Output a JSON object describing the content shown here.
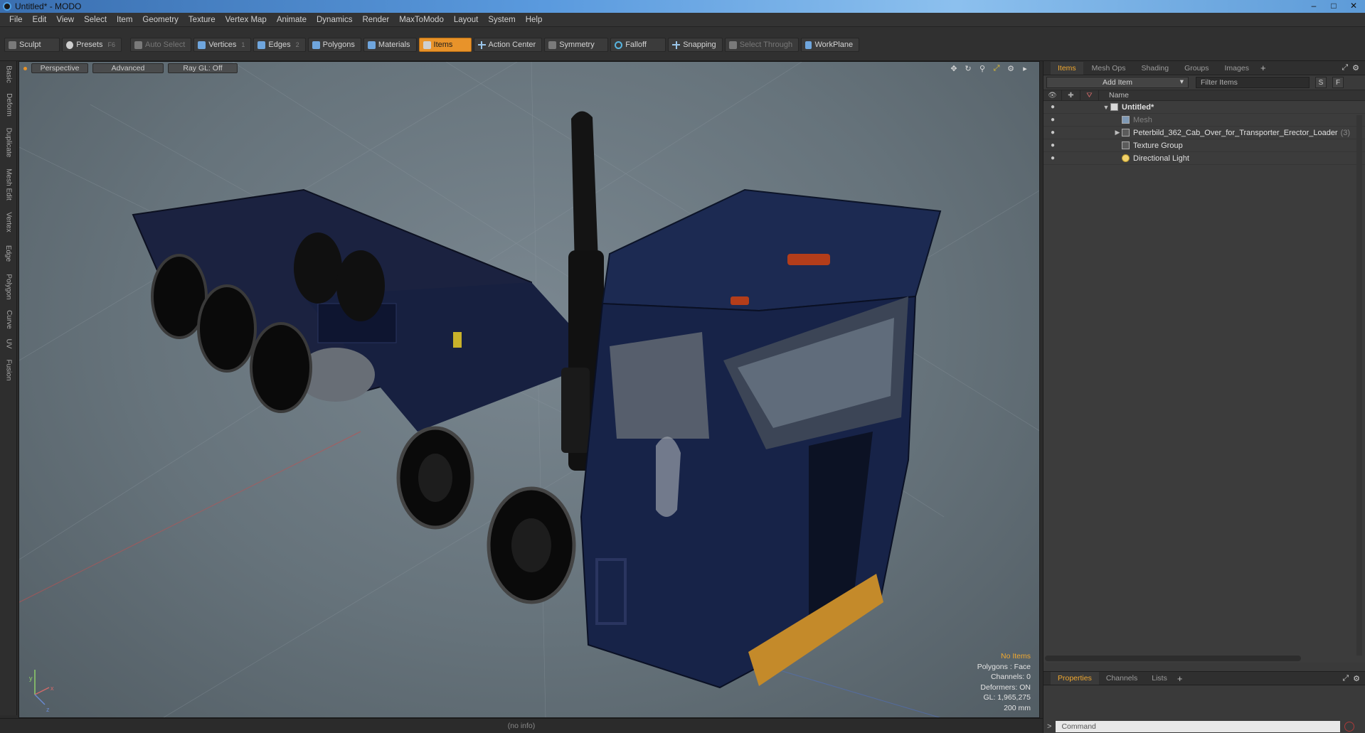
{
  "window": {
    "title": "Untitled* - MODO",
    "controls": [
      "–",
      "□",
      "✕"
    ]
  },
  "menu": [
    "File",
    "Edit",
    "View",
    "Select",
    "Item",
    "Geometry",
    "Texture",
    "Vertex Map",
    "Animate",
    "Dynamics",
    "Render",
    "MaxToModo",
    "Layout",
    "System",
    "Help"
  ],
  "toolbar": {
    "sculpt": "Sculpt",
    "presets": "Presets",
    "presets_key": "F6",
    "auto_select": "Auto Select",
    "vertices": "Vertices",
    "vertices_key": "1",
    "edges": "Edges",
    "edges_key": "2",
    "polygons": "Polygons",
    "materials": "Materials",
    "items": "Items",
    "action_center": "Action Center",
    "symmetry": "Symmetry",
    "falloff": "Falloff",
    "snapping": "Snapping",
    "select_through": "Select Through",
    "workplane": "WorkPlane",
    "accent": "#e8932a"
  },
  "left_tabs": [
    "Basic",
    "Deform",
    "Duplicate",
    "Mesh Edit",
    "Vertex",
    "Edge",
    "Polygon",
    "Curve",
    "UV",
    "Fusion"
  ],
  "viewport": {
    "view": "Perspective",
    "shading": "Advanced",
    "raygl": "Ray GL: Off",
    "info": {
      "selection": "No Items",
      "polygons": "Polygons : Face",
      "channels": "Channels: 0",
      "deformers": "Deformers: ON",
      "gl": "GL: 1,965,275",
      "scale": "200 mm"
    },
    "axis_labels": {
      "y": "y",
      "x": "x",
      "z": "z"
    }
  },
  "items_panel": {
    "tabs": [
      "Items",
      "Mesh Ops",
      "Shading",
      "Groups",
      "Images"
    ],
    "add_item": "Add Item",
    "filter_placeholder": "Filter Items",
    "s_btn": "S",
    "f_btn": "F",
    "name_header": "Name",
    "tree": [
      {
        "label": "Untitled*",
        "level": 0,
        "arrow": "▼",
        "type": "scene"
      },
      {
        "label": "Mesh",
        "level": 1,
        "arrow": "",
        "type": "mesh"
      },
      {
        "label": "Peterbild_362_Cab_Over_for_Transporter_Erector_Loader",
        "suffix": "(3)",
        "level": 1,
        "arrow": "▶",
        "type": "group"
      },
      {
        "label": "Texture Group",
        "level": 1,
        "arrow": "",
        "type": "group"
      },
      {
        "label": "Directional Light",
        "level": 1,
        "arrow": "",
        "type": "light"
      }
    ]
  },
  "properties_panel": {
    "tabs": [
      "Properties",
      "Channels",
      "Lists"
    ]
  },
  "status": {
    "info": "(no info)",
    "command_placeholder": "Command",
    "prompt": ">"
  }
}
